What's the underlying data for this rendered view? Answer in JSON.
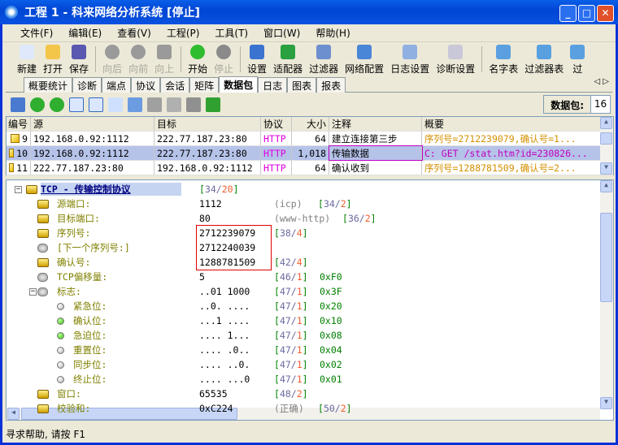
{
  "window": {
    "title": "工程 1 - 科来网络分析系统 [停止]",
    "min": "_",
    "max": "□",
    "close": "✕"
  },
  "menu": [
    "文件(F)",
    "编辑(E)",
    "查看(V)",
    "工程(P)",
    "工具(T)",
    "窗口(W)",
    "帮助(H)"
  ],
  "toolbar": [
    {
      "label": "新建",
      "icon": "new-icon",
      "color": "#dfe9fb",
      "enabled": true
    },
    {
      "label": "打开",
      "icon": "open-icon",
      "color": "#f3c64a",
      "enabled": true
    },
    {
      "label": "保存",
      "icon": "save-icon",
      "color": "#5a58b0",
      "enabled": true
    },
    {
      "sep": true
    },
    {
      "label": "向后",
      "icon": "back-icon",
      "color": "#9a9a9a",
      "enabled": false
    },
    {
      "label": "向前",
      "icon": "forward-icon",
      "color": "#9a9a9a",
      "enabled": false
    },
    {
      "label": "向上",
      "icon": "up-icon",
      "color": "#9a9a9a",
      "enabled": false
    },
    {
      "sep": true
    },
    {
      "label": "开始",
      "icon": "start-icon",
      "color": "#2fbd2f",
      "enabled": true
    },
    {
      "label": "停止",
      "icon": "stop-icon",
      "color": "#8a8a8a",
      "enabled": false
    },
    {
      "sep": true
    },
    {
      "label": "设置",
      "icon": "settings-icon",
      "color": "#3a74d0",
      "enabled": true
    },
    {
      "label": "适配器",
      "icon": "adapter-icon",
      "color": "#2aa040",
      "enabled": true
    },
    {
      "label": "过滤器",
      "icon": "filter-icon",
      "color": "#6d8fd0",
      "enabled": true
    },
    {
      "label": "网络配置",
      "icon": "network-icon",
      "color": "#4a86d8",
      "enabled": true
    },
    {
      "label": "日志设置",
      "icon": "log-icon",
      "color": "#8fb0e0",
      "enabled": true
    },
    {
      "label": "诊断设置",
      "icon": "diagnose-icon",
      "color": "#c8c8d8",
      "enabled": true
    },
    {
      "sep": true
    },
    {
      "label": "名字表",
      "icon": "name-table-icon",
      "color": "#5aa0e0",
      "enabled": true
    },
    {
      "label": "过滤器表",
      "icon": "filter-table-icon",
      "color": "#5aa0e0",
      "enabled": true
    },
    {
      "label": "过",
      "icon": "more-icon",
      "color": "#5aa0e0",
      "enabled": true
    }
  ],
  "tabs": [
    "概要统计",
    "诊断",
    "端点",
    "协议",
    "会话",
    "矩阵",
    "数据包",
    "日志",
    "图表",
    "报表"
  ],
  "active_tab": "数据包",
  "packet_count": {
    "label": "数据包:",
    "value": "16"
  },
  "table": {
    "headers": [
      "编号",
      "源",
      "目标",
      "协议",
      "大小",
      "注释",
      "概要"
    ],
    "rows": [
      [
        "9",
        "192.168.0.92:1112",
        "222.77.187.23:80",
        "HTTP",
        "64",
        "建立连接第三步",
        "序列号=2712239079,确认号=1..."
      ],
      [
        "10",
        "192.168.0.92:1112",
        "222.77.187.23:80",
        "HTTP",
        "1,018",
        "传输数据",
        "C: GET /stat.htm?id=230826..."
      ],
      [
        "11",
        "222.77.187.23:80",
        "192.168.0.92:1112",
        "HTTP",
        "64",
        "确认收到",
        "序列号=1288781509,确认号=2..."
      ]
    ],
    "selected_index": 1
  },
  "tree": [
    {
      "level": 0,
      "icon": "tcp",
      "label": "TCP - 传输控制协议",
      "value": "",
      "extra": "",
      "off": "34",
      "len": "20",
      "hex": ""
    },
    {
      "level": 1,
      "icon": "field",
      "label": "源端口:",
      "value": "1112",
      "extra": "(icp)",
      "off": "34",
      "len": "2",
      "hex": ""
    },
    {
      "level": 1,
      "icon": "field",
      "label": "目标端口:",
      "value": "80",
      "extra": "(www-http)",
      "off": "36",
      "len": "2",
      "hex": ""
    },
    {
      "level": 1,
      "icon": "field",
      "label": "序列号:",
      "value": "2712239079",
      "extra": "",
      "off": "38",
      "len": "4",
      "hex": ""
    },
    {
      "level": 1,
      "icon": "gray",
      "label": "[下一个序列号:]",
      "value": "2712240039",
      "extra": "",
      "off": "",
      "len": "",
      "hex": ""
    },
    {
      "level": 1,
      "icon": "field",
      "label": "确认号:",
      "value": "1288781509",
      "extra": "",
      "off": "42",
      "len": "4",
      "hex": ""
    },
    {
      "level": 1,
      "icon": "gray",
      "label": "TCP偏移量:",
      "value": "5",
      "extra": "",
      "off": "46",
      "len": "1",
      "hex": "0xF0"
    },
    {
      "level": 1,
      "icon": "gray",
      "label": "标志:",
      "value": "..01 1000",
      "extra": "",
      "off": "47",
      "len": "1",
      "hex": "0x3F",
      "expand": true
    },
    {
      "level": 2,
      "icon": "dot",
      "label": "紧急位:",
      "value": "..0. ....",
      "extra": "",
      "off": "47",
      "len": "1",
      "hex": "0x20"
    },
    {
      "level": 2,
      "icon": "dot-on",
      "label": "确认位:",
      "value": "...1 ....",
      "extra": "",
      "off": "47",
      "len": "1",
      "hex": "0x10"
    },
    {
      "level": 2,
      "icon": "dot-on",
      "label": "急迫位:",
      "value": ".... 1...",
      "extra": "",
      "off": "47",
      "len": "1",
      "hex": "0x08"
    },
    {
      "level": 2,
      "icon": "dot",
      "label": "重置位:",
      "value": ".... .0..",
      "extra": "",
      "off": "47",
      "len": "1",
      "hex": "0x04"
    },
    {
      "level": 2,
      "icon": "dot",
      "label": "同步位:",
      "value": ".... ..0.",
      "extra": "",
      "off": "47",
      "len": "1",
      "hex": "0x02"
    },
    {
      "level": 2,
      "icon": "dot",
      "label": "终止位:",
      "value": ".... ...0",
      "extra": "",
      "off": "47",
      "len": "1",
      "hex": "0x01"
    },
    {
      "level": 1,
      "icon": "field",
      "label": "窗口:",
      "value": "65535",
      "extra": "",
      "off": "48",
      "len": "2",
      "hex": ""
    },
    {
      "level": 1,
      "icon": "field",
      "label": "校验和:",
      "value": "0xC224",
      "extra": "(正确)",
      "off": "50",
      "len": "2",
      "hex": ""
    }
  ],
  "status": "寻求帮助, 请按 F1"
}
